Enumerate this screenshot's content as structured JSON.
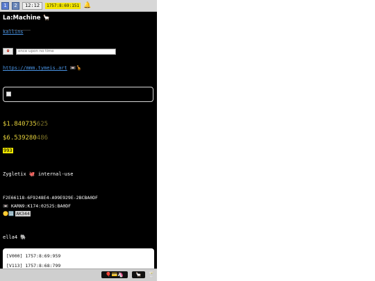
{
  "topbar": {
    "workspaces": [
      "1",
      "2"
    ],
    "clock": "12:12",
    "stamp": "1757:8:69:151",
    "bell_icon": "bell-icon"
  },
  "header": {
    "title": "La:Machine 🦙",
    "username": "kallins"
  },
  "phone": {
    "button_icon": "☎",
    "placeholder": "once upon no time"
  },
  "link": {
    "url": "https://mmm.tymeis.art",
    "emoji": "📼🦒"
  },
  "prices": [
    {
      "main": "$1.840735",
      "dim": "625"
    },
    {
      "main": "$6.539280",
      "dim": "486"
    }
  ],
  "badge": "993",
  "org": "Zygletix 🐙 internal-use",
  "ids": {
    "uuid": "F2E66118-6F9248E4-A99E929E-2BCBA0DF",
    "karn": "📼 KARN9:K174:02525:BA0DF",
    "code_prefix": "🟡🔢",
    "code": "AK344"
  },
  "handle": "ella4 🐘",
  "log": [
    "[V000] 1757:8:69:959",
    "[V113] 1757:8:68:799"
  ],
  "taskbar": {
    "tray1": "🎈💳🦄",
    "tray2": "🦙",
    "tray3": "🍸"
  },
  "colors": {
    "accent_link": "#4a95e6",
    "price_yellow": "#e6d23c",
    "badge_yellow": "#f0e800",
    "background": "#000000"
  }
}
